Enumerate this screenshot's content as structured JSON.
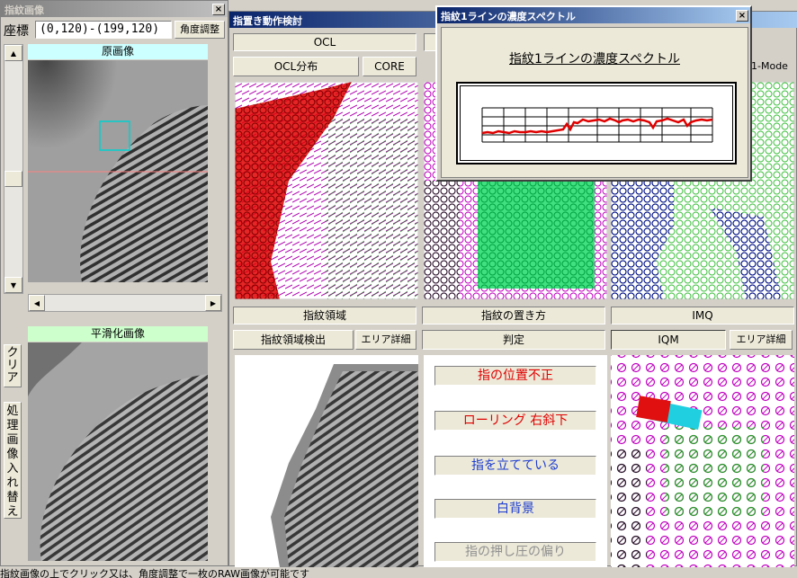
{
  "left_window": {
    "title": "指紋画像",
    "coord_label": "座標",
    "coord_value": "(0,120)-(199,120)",
    "angle_button": "角度調整",
    "original_label": "原画像",
    "smoothed_label": "平滑化画像",
    "clear_button": "クリア",
    "swap_button": "処理画像入れ替え"
  },
  "main_window": {
    "title": "指置き動作検討",
    "ocl_label": "OCL",
    "ocl_dist_button": "OCL分布",
    "core_button": "CORE",
    "mode_label": "1-Mode",
    "region_label": "指紋領域",
    "placement_label": "指紋の置き方",
    "imq_label": "IMQ",
    "region_detect_button": "指紋領域検出",
    "area_detail_button_1": "エリア詳細",
    "judge_label": "判定",
    "iqm_button": "IQM",
    "area_detail_button_2": "エリア詳細",
    "judgements": [
      {
        "text": "指の位置不正",
        "color": "#e00000"
      },
      {
        "text": "ローリング 右斜下",
        "color": "#e00000"
      },
      {
        "text": "指を立てている",
        "color": "#1c3cd0"
      },
      {
        "text": "白背景",
        "color": "#1c3cd0"
      },
      {
        "text": "指の押し圧の偏り",
        "color": "#909090"
      }
    ]
  },
  "popup": {
    "title": "指紋1ラインの濃度スペクトル",
    "heading": "指紋1ラインの濃度スペクトル"
  },
  "status_bar": "指紋画像の上でクリック又は、角度調整で一枚のRAW画像が可能です"
}
